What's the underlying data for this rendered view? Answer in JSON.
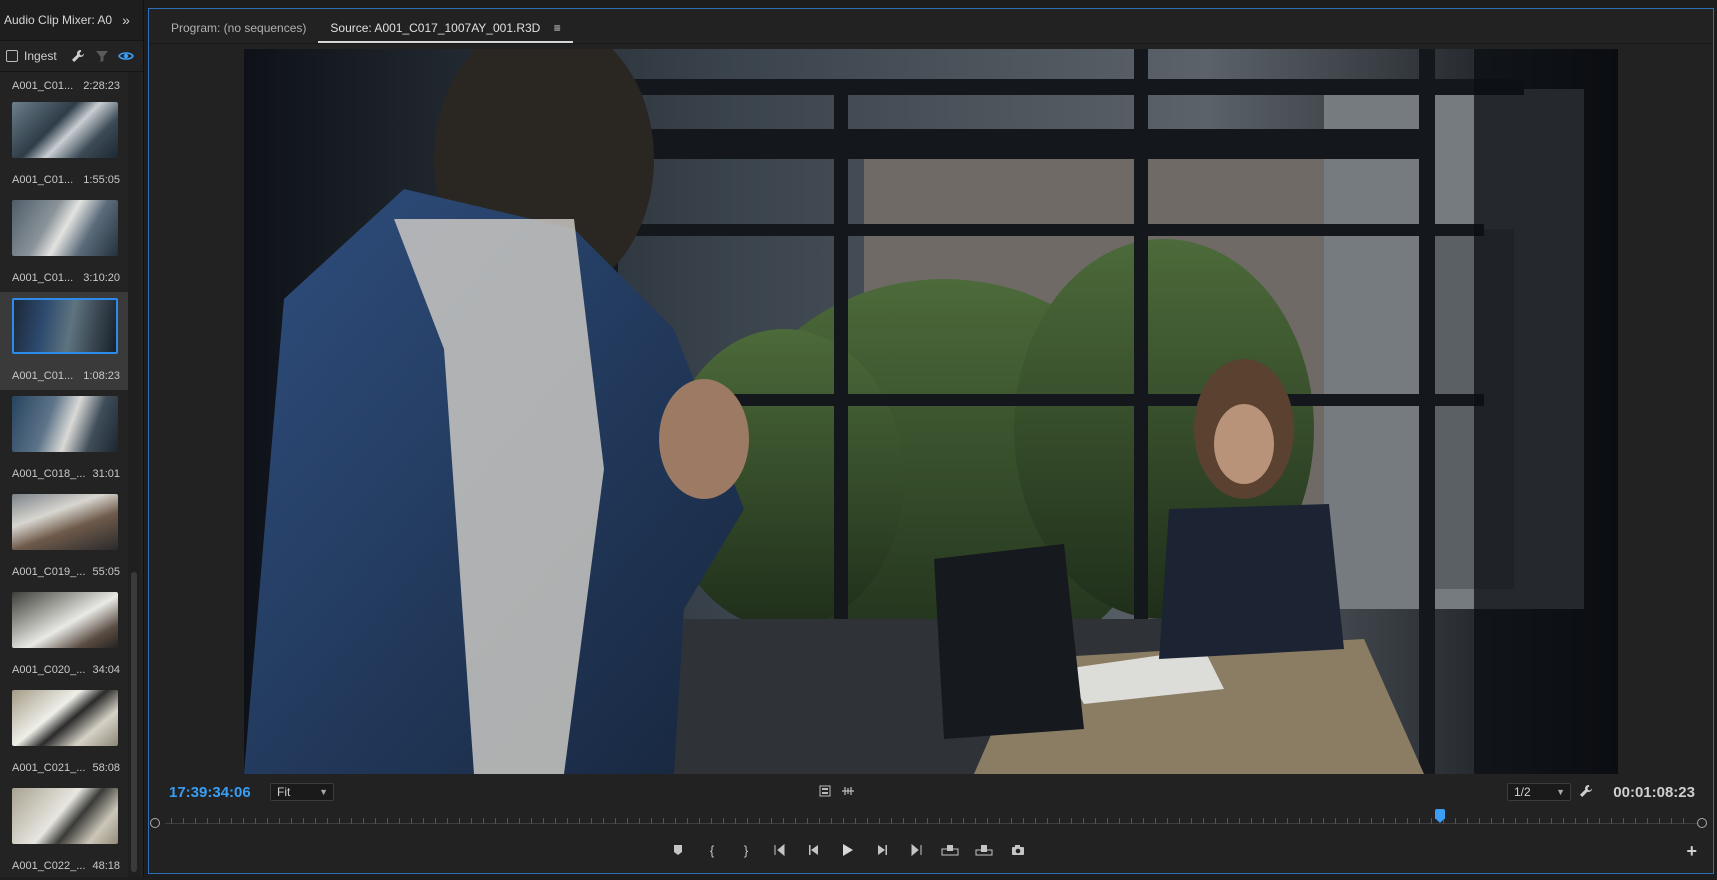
{
  "left_panel": {
    "title": "Audio Clip Mixer: A0",
    "expand_icon": "double-chevron-right-icon",
    "ingest_label": "Ingest",
    "ingest_checked": false,
    "toolbar_icons": [
      "wrench-icon",
      "filter-icon",
      "eye-icon"
    ],
    "clips": [
      {
        "name": "A001_C01...",
        "duration": "2:28:23"
      },
      {
        "name": "A001_C01...",
        "duration": "1:55:05"
      },
      {
        "name": "A001_C01...",
        "duration": "3:10:20"
      },
      {
        "name": "A001_C01...",
        "duration": "1:08:23"
      },
      {
        "name": "A001_C018_...",
        "duration": "31:01"
      },
      {
        "name": "A001_C019_...",
        "duration": "55:05"
      },
      {
        "name": "A001_C020_...",
        "duration": "34:04"
      },
      {
        "name": "A001_C021_...",
        "duration": "58:08"
      },
      {
        "name": "A001_C022_...",
        "duration": "48:18"
      }
    ]
  },
  "monitor": {
    "tabs": [
      {
        "label": "Program: (no sequences)",
        "active": false
      },
      {
        "label": "Source: A001_C017_1007AY_001.R3D",
        "active": true
      }
    ],
    "tab_menu_icon": "hamburger-menu-icon",
    "current_timecode": "17:39:34:06",
    "zoom_select": "Fit",
    "resolution_select": "1/2",
    "duration_timecode": "00:01:08:23",
    "playhead_fraction": 0.83,
    "accent_color": "#3a9ef5"
  },
  "transport": {
    "buttons": [
      "add-marker-icon",
      "mark-in-icon",
      "mark-out-icon",
      "go-to-in-icon",
      "step-back-icon",
      "play-icon",
      "step-forward-icon",
      "go-to-out-icon",
      "insert-icon",
      "overwrite-icon",
      "export-frame-icon"
    ],
    "add_button": "+"
  }
}
